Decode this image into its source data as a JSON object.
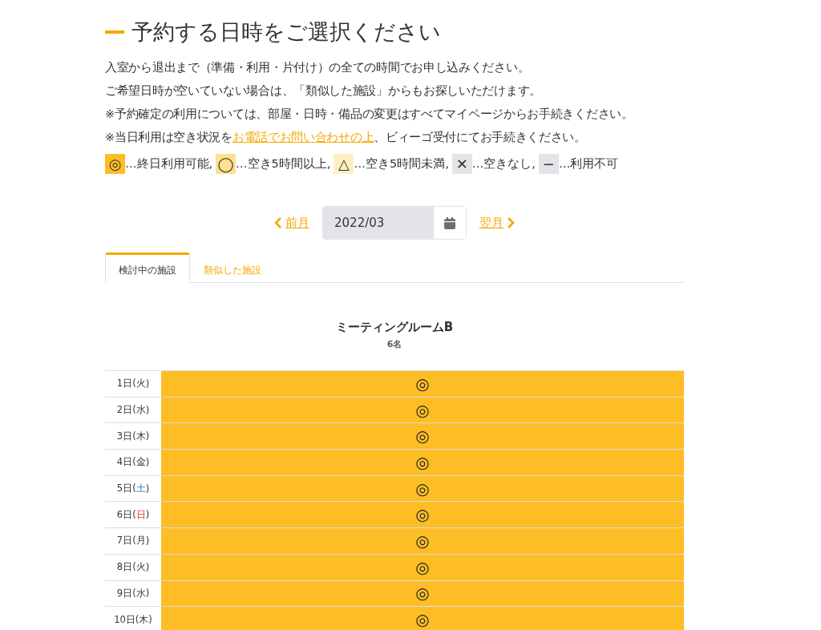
{
  "heading": "予約する日時をご選択ください",
  "notes": [
    {
      "text": "入室から退出まで（準備・利用・片付け）の全ての時間でお申し込みください。"
    },
    {
      "text": "ご希望日時が空いていない場合は、「類似した施設」からもお探しいただけます。"
    },
    {
      "text": "※予約確定の利用については、部屋・日時・備品の変更はすべてマイページからお手続きください。"
    },
    {
      "text": "※当日利用は空き状況を",
      "link": "お電話でお問い合わせの上",
      "after": "、ビィーゴ受付にてお手続きください。"
    }
  ],
  "legend": [
    {
      "kind": "full",
      "symbol": "◎",
      "label": "…終日利用可能,"
    },
    {
      "kind": "over5",
      "symbol": "◯",
      "label": "…空き5時間以上,"
    },
    {
      "kind": "under5",
      "symbol": "△",
      "label": "…空き5時間未満,"
    },
    {
      "kind": "none",
      "symbol": "✕",
      "label": "…空きなし,"
    },
    {
      "kind": "closed",
      "symbol": "−",
      "label": "…利用不可"
    }
  ],
  "month_nav": {
    "prev": "前月",
    "value": "2022/03",
    "next": "翌月"
  },
  "tabs": [
    {
      "label": "検討中の施設",
      "selected": true
    },
    {
      "label": "類似した施設",
      "selected": false
    }
  ],
  "facility": {
    "name": "ミーティングルームB",
    "capacity": "6名"
  },
  "rows": [
    {
      "day": "1日(",
      "weekday": "火",
      "close": ")",
      "kind": "weekday",
      "slot": {
        "kind": "full",
        "symbol": "◎"
      }
    },
    {
      "day": "2日(",
      "weekday": "水",
      "close": ")",
      "kind": "weekday",
      "slot": {
        "kind": "full",
        "symbol": "◎"
      }
    },
    {
      "day": "3日(",
      "weekday": "木",
      "close": ")",
      "kind": "weekday",
      "slot": {
        "kind": "full",
        "symbol": "◎"
      }
    },
    {
      "day": "4日(",
      "weekday": "金",
      "close": ")",
      "kind": "weekday",
      "slot": {
        "kind": "full",
        "symbol": "◎"
      }
    },
    {
      "day": "5日(",
      "weekday": "土",
      "close": ")",
      "kind": "saturday",
      "slot": {
        "kind": "full",
        "symbol": "◎"
      }
    },
    {
      "day": "6日(",
      "weekday": "日",
      "close": ")",
      "kind": "sunday",
      "slot": {
        "kind": "full",
        "symbol": "◎"
      }
    },
    {
      "day": "7日(",
      "weekday": "月",
      "close": ")",
      "kind": "weekday",
      "slot": {
        "kind": "full",
        "symbol": "◎"
      }
    },
    {
      "day": "8日(",
      "weekday": "火",
      "close": ")",
      "kind": "weekday",
      "slot": {
        "kind": "full",
        "symbol": "◎"
      }
    },
    {
      "day": "9日(",
      "weekday": "水",
      "close": ")",
      "kind": "weekday",
      "slot": {
        "kind": "full",
        "symbol": "◎"
      }
    },
    {
      "day": "10日(",
      "weekday": "木",
      "close": ")",
      "kind": "weekday",
      "slot": {
        "kind": "full",
        "symbol": "◎"
      }
    }
  ]
}
